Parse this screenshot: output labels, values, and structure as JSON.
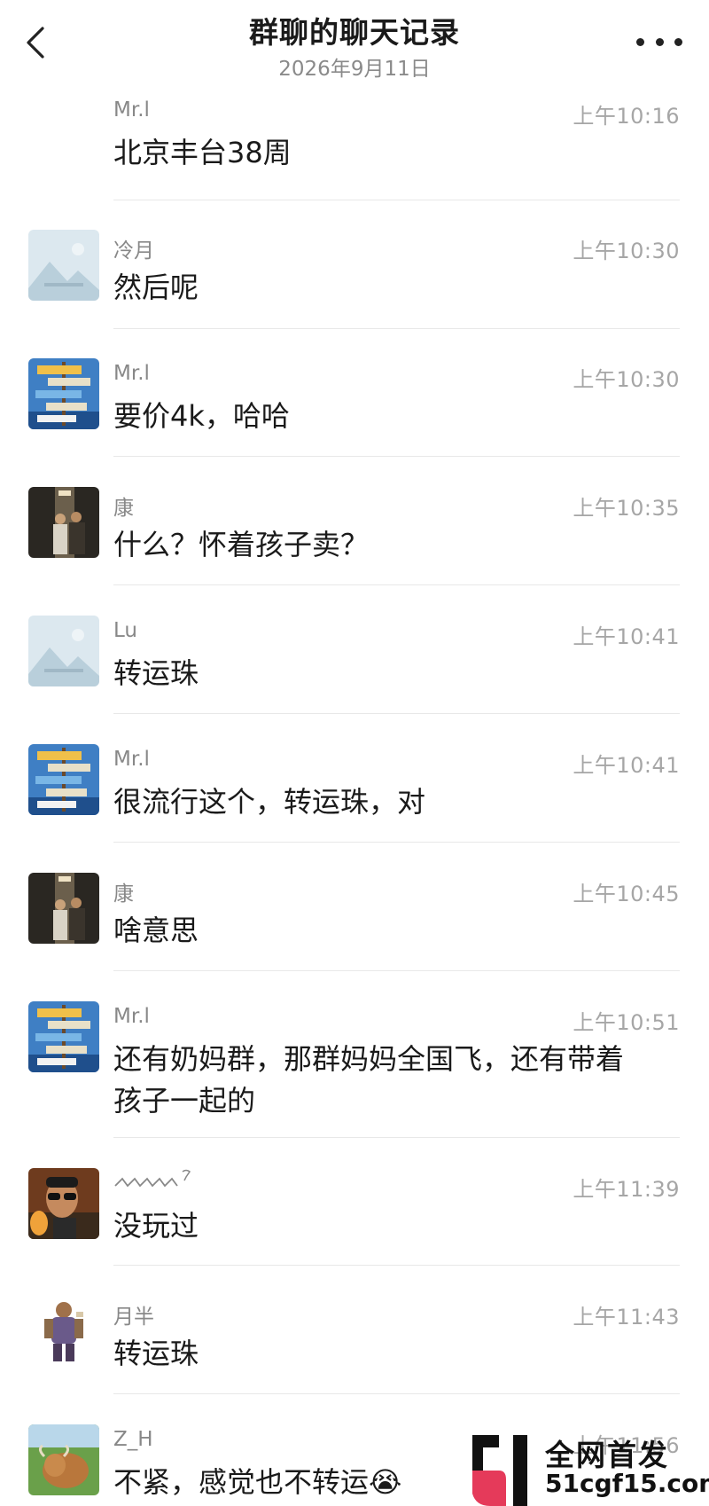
{
  "header": {
    "title": "群聊的聊天记录",
    "date": "2026年9月11日"
  },
  "messages": [
    {
      "sender": "Mr.l",
      "time": "上午10:16",
      "text": "北京丰台38周",
      "avatar": "none"
    },
    {
      "sender": "冷月",
      "time": "上午10:30",
      "text": "然后呢",
      "avatar": "placeholder-image-icon"
    },
    {
      "sender": "Mr.l",
      "time": "上午10:30",
      "text": "要价4k，哈哈",
      "avatar": "signpost-avatar"
    },
    {
      "sender": "康",
      "time": "上午10:35",
      "text": "什么？怀着孩子卖？",
      "avatar": "two-people-photo-avatar"
    },
    {
      "sender": "Lu",
      "time": "上午10:41",
      "text": "转运珠",
      "avatar": "placeholder-image-icon"
    },
    {
      "sender": "Mr.l",
      "time": "上午10:41",
      "text": "很流行这个，转运珠，对",
      "avatar": "signpost-avatar"
    },
    {
      "sender": "康",
      "time": "上午10:45",
      "text": "啥意思",
      "avatar": "two-people-photo-avatar"
    },
    {
      "sender": "Mr.l",
      "time": "上午10:51",
      "text_lines": [
        "还有奶妈群，那群妈妈全国飞，还有带着",
        "孩子一起的"
      ],
      "avatar": "signpost-avatar"
    },
    {
      "sender": "",
      "time": "上午11:39",
      "text": "没玩过",
      "avatar": "sunglasses-man-avatar"
    },
    {
      "sender": "月半",
      "time": "上午11:43",
      "text": "转运珠",
      "avatar": "game-character-avatar"
    },
    {
      "sender": "Z_H",
      "time": "上午11:56",
      "text": "不紧，感觉也不转运😭",
      "avatar": "highland-cow-avatar"
    }
  ],
  "watermark": {
    "line1": "全网首发",
    "line2": "51cgf15.com"
  }
}
